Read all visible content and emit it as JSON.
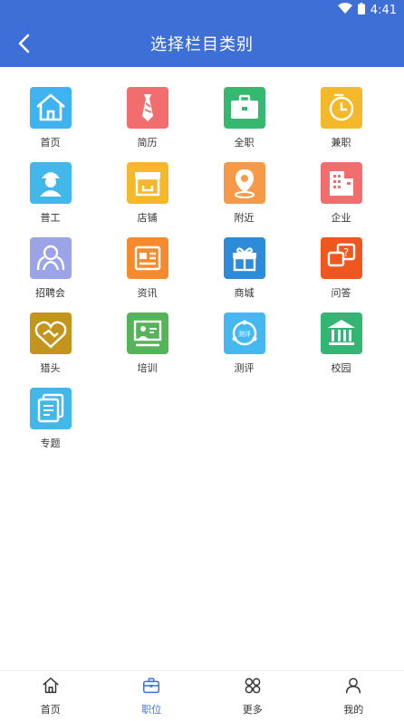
{
  "status": {
    "time": "4:41"
  },
  "header": {
    "title": "选择栏目类别"
  },
  "rows": [
    [
      {
        "label": "首页",
        "color": "#3fb3ef",
        "icon": "home-icon"
      },
      {
        "label": "简历",
        "color": "#f26d6d",
        "icon": "tie-icon"
      },
      {
        "label": "全职",
        "color": "#35b86f",
        "icon": "briefcase-icon"
      },
      {
        "label": "兼职",
        "color": "#f4b92a",
        "icon": "clock-icon"
      }
    ],
    [
      {
        "label": "普工",
        "color": "#42b7ea",
        "icon": "worker-icon"
      },
      {
        "label": "店铺",
        "color": "#f4b92a",
        "icon": "shop-icon"
      },
      {
        "label": "附近",
        "color": "#f59a49",
        "icon": "location-icon"
      },
      {
        "label": "企业",
        "color": "#f26d6d",
        "icon": "building-icon"
      }
    ],
    [
      {
        "label": "招聘会",
        "color": "#9aa4e6",
        "icon": "people-icon"
      },
      {
        "label": "资讯",
        "color": "#f58a2e",
        "icon": "news-icon"
      },
      {
        "label": "商城",
        "color": "#2e8bda",
        "icon": "gift-icon"
      },
      {
        "label": "问答",
        "color": "#f0571e",
        "icon": "question-icon"
      }
    ],
    [
      {
        "label": "猎头",
        "color": "#c4951d",
        "icon": "handshake-icon"
      },
      {
        "label": "培训",
        "color": "#55b35a",
        "icon": "training-icon"
      },
      {
        "label": "测评",
        "color": "#45b8ef",
        "icon": "test-icon"
      },
      {
        "label": "校园",
        "color": "#35b574",
        "icon": "school-icon"
      }
    ],
    [
      {
        "label": "专题",
        "color": "#42b7ea",
        "icon": "topic-icon"
      }
    ]
  ],
  "tabs": [
    {
      "label": "首页",
      "icon": "home-icon"
    },
    {
      "label": "职位",
      "icon": "briefcase-icon",
      "active": true
    },
    {
      "label": "更多",
      "icon": "more-icon"
    },
    {
      "label": "我的",
      "icon": "user-icon"
    }
  ]
}
